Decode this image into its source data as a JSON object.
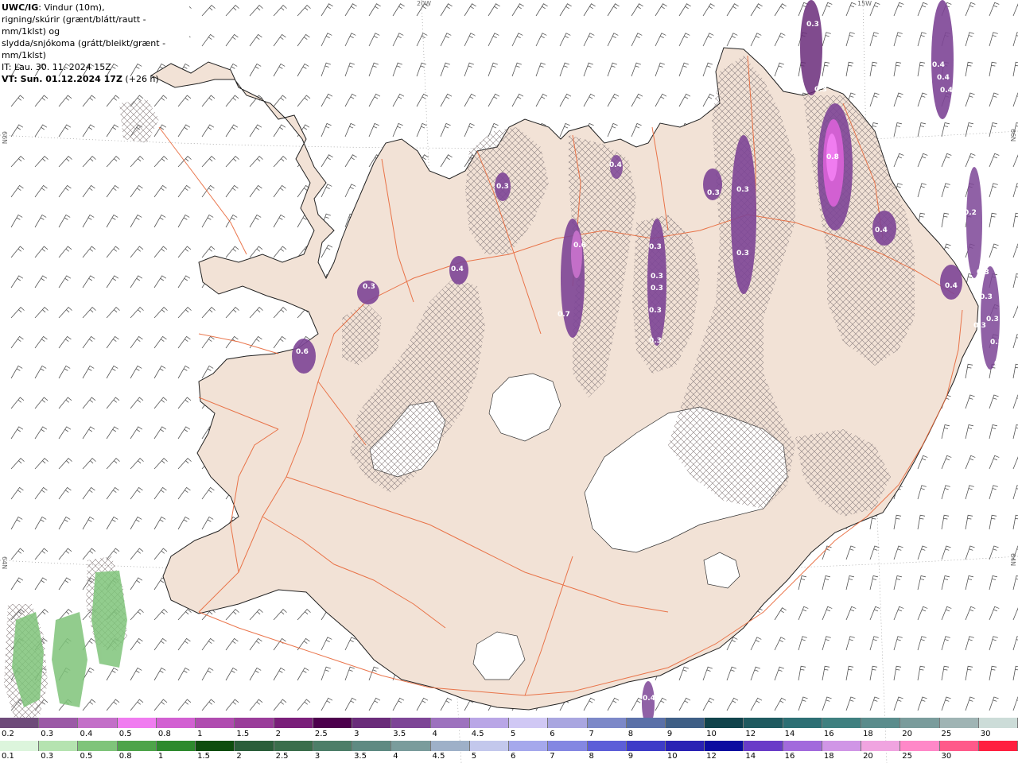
{
  "header": {
    "model": "UWC/IG",
    "line1_rest": ": Vindur (10m),",
    "line2": "rigning/skúrir (grænt/blátt/rautt - mm/1klst) og",
    "line3": "slydda/snjókoma (grátt/bleikt/grænt - mm/1klst)",
    "line4": "IT: Lau. 30. 11. 2024 15Z",
    "line5_bold": "VT: Sun. 01.12.2024 17Z",
    "line5_rest": " (+26 h)"
  },
  "coords": {
    "top_left_lon": "20W",
    "top_right_lon": "15W",
    "left_top_lat": "66N",
    "left_bottom_lat": "64N",
    "right_top_lat": "66N",
    "right_bottom_lat": "64N"
  },
  "precip_labels": [
    {
      "text": "0.3"
    },
    {
      "text": "0.4"
    },
    {
      "text": "0.4"
    },
    {
      "text": "0.4"
    },
    {
      "text": "0.3"
    },
    {
      "text": "0.8"
    },
    {
      "text": "0.4"
    },
    {
      "text": "0.3"
    },
    {
      "text": "0.3"
    },
    {
      "text": "0.3"
    },
    {
      "text": "0.3"
    },
    {
      "text": "0.4"
    },
    {
      "text": "0.6"
    },
    {
      "text": "0.3"
    },
    {
      "text": "0.4"
    },
    {
      "text": "0.3"
    },
    {
      "text": "0.6"
    },
    {
      "text": "0.3"
    },
    {
      "text": "0.3"
    },
    {
      "text": "0.7"
    },
    {
      "text": "0.3"
    },
    {
      "text": "0.3"
    },
    {
      "text": "0.3"
    },
    {
      "text": "0.4"
    },
    {
      "text": "0.2"
    },
    {
      "text": "0.3"
    },
    {
      "text": "0.3"
    },
    {
      "text": "0.5"
    },
    {
      "text": "0.3"
    },
    {
      "text": "0.3"
    },
    {
      "text": "0.4"
    }
  ],
  "snow_scale": {
    "labels": [
      "0.2",
      "0.3",
      "0.4",
      "0.5",
      "0.8",
      "1",
      "1.5",
      "2",
      "2.5",
      "3",
      "3.5",
      "4",
      "4.5",
      "5",
      "6",
      "7",
      "8",
      "9",
      "10",
      "12",
      "14",
      "16",
      "18",
      "20",
      "25",
      "30"
    ],
    "colors": [
      "#6e4b7a",
      "#9b59a6",
      "#c36fc8",
      "#f07cf0",
      "#d260d2",
      "#b04cb0",
      "#9a3d9a",
      "#7a1f7a",
      "#4d004d",
      "#6a2c7a",
      "#7d4596",
      "#9d72be",
      "#b9a6e6",
      "#d0c8f4",
      "#a9a6e0",
      "#7c88c8",
      "#5a70a8",
      "#3f5f86",
      "#11434c",
      "#1f5a60",
      "#2d6f74",
      "#3f8080",
      "#5a8c8c",
      "#7a9c9c",
      "#9fb4b4",
      "#ccdcd8"
    ]
  },
  "rain_scale": {
    "labels": [
      "0.1",
      "0.3",
      "0.5",
      "0.8",
      "1",
      "1.5",
      "2",
      "2.5",
      "3",
      "3.5",
      "4",
      "4.5",
      "5",
      "6",
      "7",
      "8",
      "9",
      "10",
      "12",
      "14",
      "16",
      "18",
      "20",
      "25",
      "30"
    ],
    "colors": [
      "#dcf5dc",
      "#b5e3b0",
      "#7fc47a",
      "#4ea44a",
      "#2e8a2e",
      "#0e4d0e",
      "#2b5e3a",
      "#3b6e4c",
      "#4d7e68",
      "#5f8a82",
      "#7a9c9c",
      "#9eb0c8",
      "#c3c8ec",
      "#a5a8ec",
      "#8487e2",
      "#5d5ed8",
      "#3e3cc8",
      "#2a22b4",
      "#0c0ca0",
      "#6a3cc8",
      "#a26adc",
      "#d096e6",
      "#f0a4e0",
      "#ff88c8",
      "#ff5a8a",
      "#ff2040"
    ]
  }
}
